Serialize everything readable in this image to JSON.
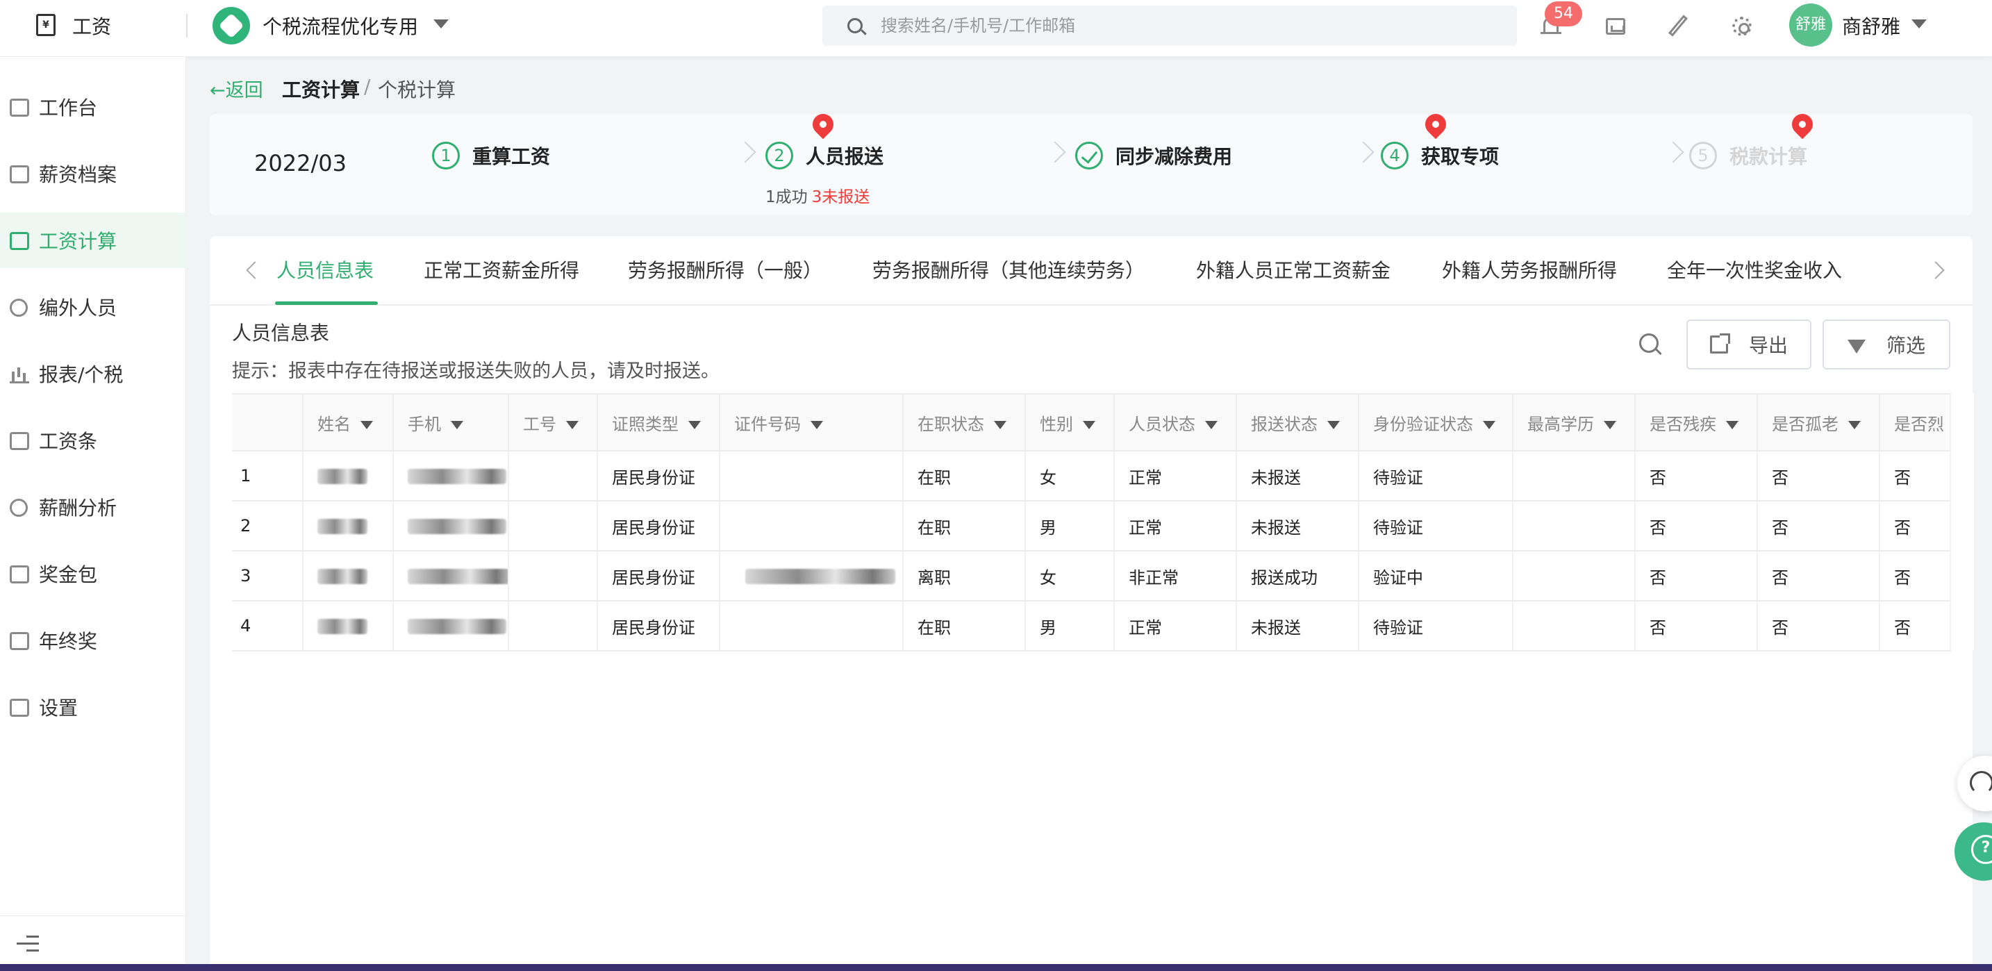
{
  "topbar": {
    "app_icon_glyph": "¥",
    "app_name": "工资",
    "company": "个税流程优化专用",
    "search_placeholder": "搜索姓名/手机号/工作邮箱",
    "notification_count": "54",
    "avatar_text": "舒雅",
    "user_name": "商舒雅",
    "icons": [
      "bell-icon",
      "inbox-icon",
      "edit-icon",
      "settings-icon"
    ]
  },
  "sidebar": {
    "items": [
      {
        "label": "工作台",
        "icon": "dashboard-icon"
      },
      {
        "label": "薪资档案",
        "icon": "profile-icon"
      },
      {
        "label": "工资计算",
        "icon": "calendar-icon",
        "active": true
      },
      {
        "label": "编外人员",
        "icon": "people-icon"
      },
      {
        "label": "报表/个税",
        "icon": "bar-chart-icon"
      },
      {
        "label": "工资条",
        "icon": "payslip-icon"
      },
      {
        "label": "薪酬分析",
        "icon": "analysis-icon"
      },
      {
        "label": "奖金包",
        "icon": "folder-icon"
      },
      {
        "label": "年终奖",
        "icon": "gift-icon"
      },
      {
        "label": "设置",
        "icon": "gear-icon"
      }
    ]
  },
  "breadcrumb": {
    "back": "←返回",
    "current": "工资计算",
    "separator": "/",
    "leaf": "个税计算"
  },
  "steps": {
    "period": "2022/03",
    "items": [
      {
        "num": "1",
        "label": "重算工资"
      },
      {
        "num": "2",
        "label": "人员报送"
      },
      {
        "num": "",
        "label": "同步减除费用"
      },
      {
        "num": "4",
        "label": "获取专项"
      },
      {
        "num": "5",
        "label": "税款计算"
      }
    ],
    "report_success": "1成功",
    "report_pending": "3未报送"
  },
  "tabs": [
    "人员信息表",
    "正常工资薪金所得",
    "劳务报酬所得（一般）",
    "劳务报酬所得（其他连续劳务）",
    "外籍人员正常工资薪金",
    "外籍人劳务报酬所得",
    "全年一次性奖金收入"
  ],
  "table": {
    "title": "人员信息表",
    "tip": "提示：报表中存在待报送或报送失败的人员，请及时报送。",
    "export": "导出",
    "filter": "筛选",
    "columns": [
      "姓名",
      "手机",
      "工号",
      "证照类型",
      "证件号码",
      "在职状态",
      "性别",
      "人员状态",
      "报送状态",
      "身份验证状态",
      "最高学历",
      "是否残疾",
      "是否孤老",
      "是否烈"
    ],
    "rows": [
      {
        "idx": "1",
        "id_type": "居民身份证",
        "employment": "在职",
        "gender": "女",
        "person_status": "正常",
        "report_status": "未报送",
        "verify_status": "待验证",
        "disabled": "否",
        "elderly": "否",
        "martyr": "否"
      },
      {
        "idx": "2",
        "id_type": "居民身份证",
        "employment": "在职",
        "gender": "男",
        "person_status": "正常",
        "report_status": "未报送",
        "verify_status": "待验证",
        "disabled": "否",
        "elderly": "否",
        "martyr": "否"
      },
      {
        "idx": "3",
        "id_type": "居民身份证",
        "employment": "离职",
        "gender": "女",
        "person_status": "非正常",
        "report_status": "报送成功",
        "verify_status": "验证中",
        "disabled": "否",
        "elderly": "否",
        "martyr": "否"
      },
      {
        "idx": "4",
        "id_type": "居民身份证",
        "employment": "在职",
        "gender": "男",
        "person_status": "正常",
        "report_status": "未报送",
        "verify_status": "待验证",
        "disabled": "否",
        "elderly": "否",
        "martyr": "否"
      }
    ]
  },
  "colors": {
    "accent": "#2fae6f",
    "danger": "#ee3b3b",
    "badge": "#f56c6c"
  }
}
